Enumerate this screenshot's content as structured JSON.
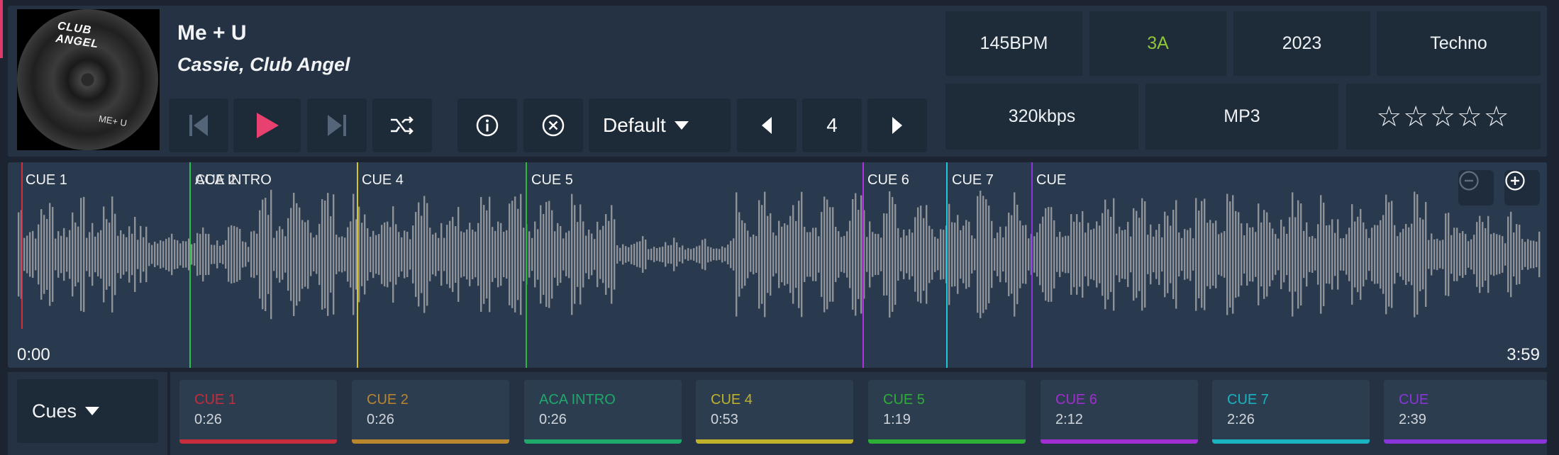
{
  "track": {
    "title": "Me + U",
    "artist": "Cassie, Club Angel",
    "artwork_text": "CLUB ANGEL",
    "artwork_sub": "ME+ U"
  },
  "controls": {
    "prev_icon": "skip-previous-icon",
    "play_icon": "play-icon",
    "next_icon": "skip-next-icon",
    "shuffle_icon": "shuffle-icon",
    "info_icon": "info-icon",
    "close_icon": "close-circle-icon",
    "profile_label": "Default",
    "page_number": "4"
  },
  "info": {
    "bpm": "145BPM",
    "key": "3A",
    "year": "2023",
    "genre": "Techno",
    "bitrate": "320kbps",
    "format": "MP3",
    "rating_stars": "☆☆☆☆☆",
    "rating_value": 0
  },
  "waveform": {
    "start_time": "0:00",
    "end_time": "3:59",
    "cue_labels": [
      "CUE 1",
      "ACA INTRO",
      "CUE 2",
      "CUE 4",
      "CUE 5",
      "CUE 6",
      "CUE 7",
      "CUE"
    ]
  },
  "cues_panel": {
    "dropdown_label": "Cues",
    "items": [
      {
        "name": "CUE 1",
        "time": "0:26",
        "color": "#c62c3b"
      },
      {
        "name": "CUE 2",
        "time": "0:26",
        "color": "#b8862d"
      },
      {
        "name": "ACA INTRO",
        "time": "0:26",
        "color": "#1ea86a"
      },
      {
        "name": "CUE 4",
        "time": "0:53",
        "color": "#bfb12a"
      },
      {
        "name": "CUE 5",
        "time": "1:19",
        "color": "#2cae37"
      },
      {
        "name": "CUE 6",
        "time": "2:12",
        "color": "#a12ed0"
      },
      {
        "name": "CUE 7",
        "time": "2:26",
        "color": "#1ab3c1"
      },
      {
        "name": "CUE",
        "time": "2:39",
        "color": "#8a35d9"
      }
    ]
  },
  "colors": {
    "accent_play": "#e8416f",
    "key_color": "#8fc43a"
  }
}
